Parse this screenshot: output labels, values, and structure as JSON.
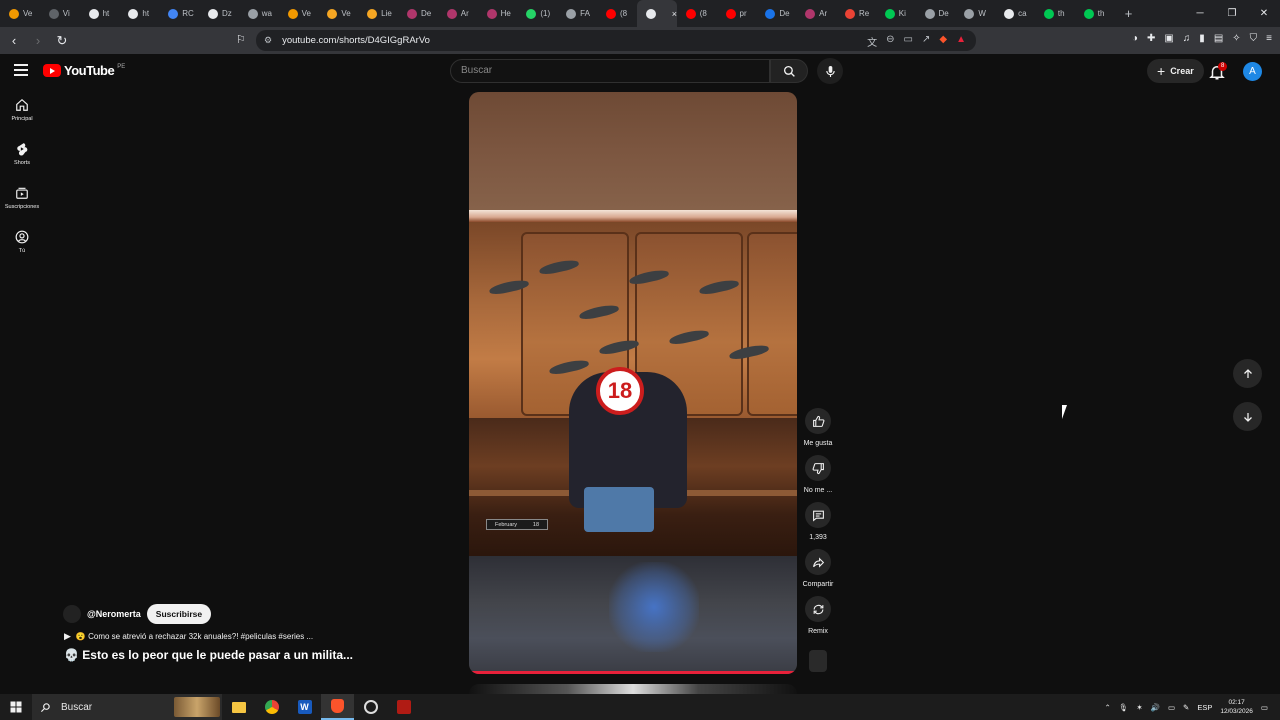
{
  "browser": {
    "tabs": [
      {
        "label": "Ve",
        "color": "#f29900"
      },
      {
        "label": "Vi",
        "color": "#5f6368"
      },
      {
        "label": "ht",
        "color": "#e8eaed"
      },
      {
        "label": "ht",
        "color": "#e8eaed"
      },
      {
        "label": "RC",
        "color": "#4285f4"
      },
      {
        "label": "Dz",
        "color": "#e8eaed"
      },
      {
        "label": "wa",
        "color": "#9aa0a6"
      },
      {
        "label": "Ve",
        "color": "#f29900"
      },
      {
        "label": "Ve",
        "color": "#f5a623"
      },
      {
        "label": "Lie",
        "color": "#f5a623"
      },
      {
        "label": "De",
        "color": "#b0366b"
      },
      {
        "label": "Ar",
        "color": "#b0366b"
      },
      {
        "label": "He",
        "color": "#b0366b"
      },
      {
        "label": "(1)",
        "color": "#25d366"
      },
      {
        "label": "FA",
        "color": "#9aa0a6"
      },
      {
        "label": "(8",
        "color": "#ff0000"
      },
      {
        "label": "",
        "color": "#e8eaed"
      },
      {
        "label": "(8",
        "color": "#ff0000"
      },
      {
        "label": "pr",
        "color": "#ff0000"
      },
      {
        "label": "De",
        "color": "#1a73e8"
      },
      {
        "label": "Ar",
        "color": "#b0366b"
      },
      {
        "label": "Re",
        "color": "#ea4335"
      },
      {
        "label": "Ki",
        "color": "#00c853"
      },
      {
        "label": "De",
        "color": "#9aa0a6"
      },
      {
        "label": "W",
        "color": "#9aa0a6"
      },
      {
        "label": "ca",
        "color": "#e8eaed"
      },
      {
        "label": "th",
        "color": "#00c853"
      },
      {
        "label": "th",
        "color": "#00c853"
      }
    ],
    "url": "youtube.com/shorts/D4GIGgRArVo"
  },
  "youtube": {
    "logo_text": "YouTube",
    "country_code": "PE",
    "search_placeholder": "Buscar",
    "create_label": "Crear",
    "notification_count": "8",
    "avatar_letter": "A",
    "sidebar": [
      {
        "label": "Principal",
        "icon": "home-icon"
      },
      {
        "label": "Shorts",
        "icon": "shorts-icon"
      },
      {
        "label": "Suscripciones",
        "icon": "subscriptions-icon"
      },
      {
        "label": "Tú",
        "icon": "you-icon"
      }
    ],
    "actions": {
      "like": "Me gusta",
      "dislike": "No me ...",
      "comments": "1,393",
      "share": "Compartir",
      "remix": "Remix"
    },
    "video": {
      "badge": "18",
      "date_card_month": "February",
      "date_card_day": "18"
    },
    "channel": {
      "handle": "@Neromerta",
      "subscribe": "Suscribirse"
    },
    "sound_text": "😮 Como se atrevió a rechazar 32k anuales?! #peliculas #series ...",
    "title": "💀 Esto es lo peor que le puede pasar a un milita..."
  },
  "taskbar": {
    "search_label": "Buscar",
    "language": "ESP",
    "time": "02:17",
    "date": "12/03/2026"
  }
}
